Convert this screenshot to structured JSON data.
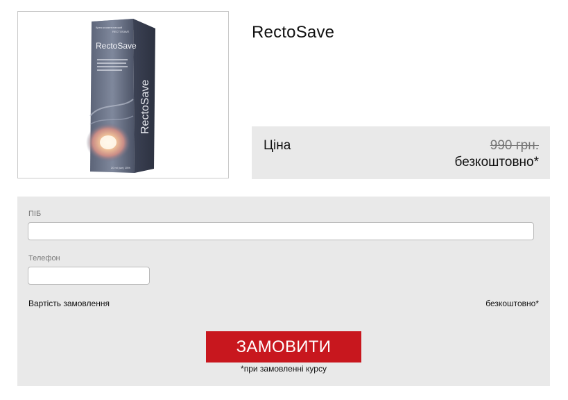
{
  "product": {
    "title": "RectoSave",
    "image_alt": "RectoSave product box",
    "box": {
      "brand": "RectoSave",
      "top_text": "Крем косметический",
      "brand_small": "RECTOSAVE",
      "description": "Косметический крем для облегчения дискомфорта при геморрое",
      "volume": "20 ml (мл) 15%"
    }
  },
  "price": {
    "label": "Ціна",
    "old": "990 грн.",
    "new": "безкоштовно*"
  },
  "form": {
    "name_label": "ПІБ",
    "name_value": "",
    "phone_label": "Телефон",
    "phone_value": "",
    "cost_label": "Вартість замовлення",
    "cost_value": "безкоштовно*",
    "submit_label": "ЗАМОВИТИ",
    "footnote": "*при замовленні курсу"
  },
  "colors": {
    "accent": "#c8171e",
    "panel_bg": "#e9e9e9"
  }
}
